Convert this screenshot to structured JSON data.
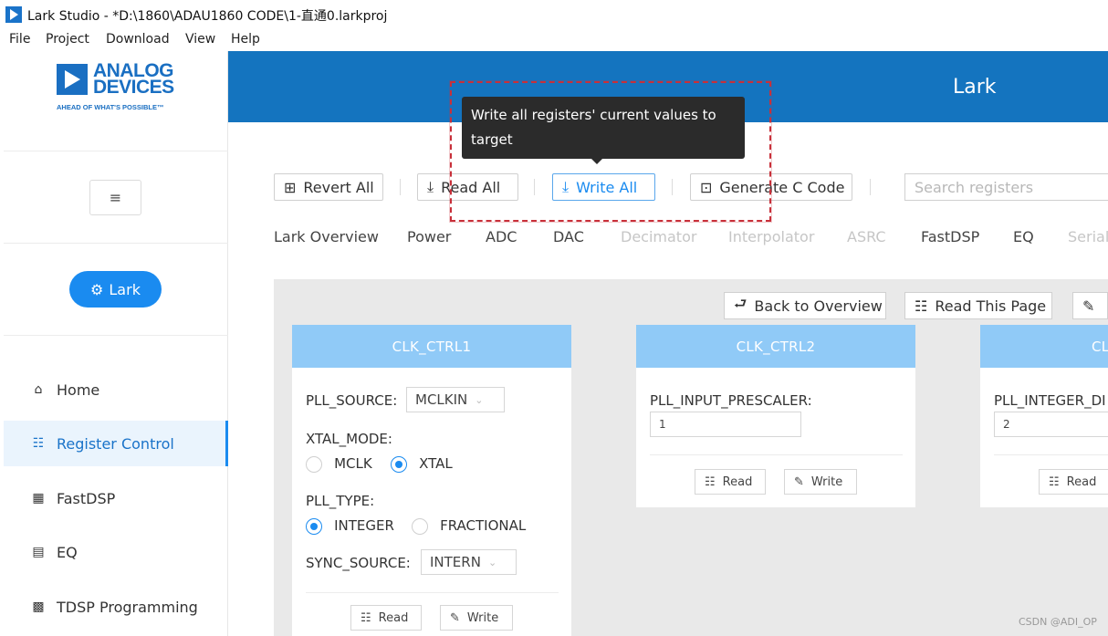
{
  "window": {
    "title": "Lark Studio - *D:\\1860\\ADAU1860 CODE\\1-直通0.larkproj"
  },
  "menu": [
    "File",
    "Project",
    "Download",
    "View",
    "Help"
  ],
  "brand": {
    "line1": "ANALOG",
    "line2": "DEVICES",
    "tagline": "AHEAD OF WHAT'S POSSIBLE™"
  },
  "sidebar": {
    "toggle_icon": "menu-fold-icon",
    "pill_label": "Lark",
    "items": [
      {
        "label": "Home",
        "icon": "home-icon"
      },
      {
        "label": "Register Control",
        "icon": "register-control-icon",
        "active": true
      },
      {
        "label": "FastDSP",
        "icon": "fastdsp-icon"
      },
      {
        "label": "EQ",
        "icon": "eq-icon"
      },
      {
        "label": "TDSP Programming",
        "icon": "tdsp-icon"
      }
    ]
  },
  "header": {
    "title": "Lark"
  },
  "toolbar": {
    "revert_all": "Revert All",
    "read_all": "Read All",
    "write_all": "Write All",
    "generate_c": "Generate C Code",
    "search_placeholder": "Search registers"
  },
  "tooltip": {
    "text": "Write all registers' current values to target"
  },
  "tabs": [
    {
      "label": "Lark Overview",
      "enabled": true
    },
    {
      "label": "Power",
      "enabled": true
    },
    {
      "label": "ADC",
      "enabled": true
    },
    {
      "label": "DAC",
      "enabled": true
    },
    {
      "label": "Decimator",
      "enabled": false
    },
    {
      "label": "Interpolator",
      "enabled": false
    },
    {
      "label": "ASRC",
      "enabled": false
    },
    {
      "label": "FastDSP",
      "enabled": true
    },
    {
      "label": "EQ",
      "enabled": true
    },
    {
      "label": "Serial",
      "enabled": false
    }
  ],
  "page_actions": {
    "back": "Back to Overview",
    "read_page": "Read This Page"
  },
  "cards": {
    "clk_ctrl1": {
      "title": "CLK_CTRL1",
      "pll_source_label": "PLL_SOURCE:",
      "pll_source_value": "MCLKIN",
      "xtal_mode_label": "XTAL_MODE:",
      "xtal_mode_options": [
        "MCLK",
        "XTAL"
      ],
      "xtal_mode_selected": "XTAL",
      "pll_type_label": "PLL_TYPE:",
      "pll_type_options": [
        "INTEGER",
        "FRACTIONAL"
      ],
      "pll_type_selected": "INTEGER",
      "sync_source_label": "SYNC_SOURCE:",
      "sync_source_value": "INTERN",
      "read": "Read",
      "write": "Write"
    },
    "clk_ctrl2": {
      "title": "CLK_CTRL2",
      "field_label": "PLL_INPUT_PRESCALER:",
      "field_value": "1",
      "read": "Read",
      "write": "Write"
    },
    "clk_ctrl3": {
      "title": "CLK",
      "field_label": "PLL_INTEGER_DI",
      "field_value": "2",
      "read": "Read"
    }
  },
  "watermark": "CSDN @ADI_OP",
  "colors": {
    "header_blue": "#1474bf",
    "accent": "#1a8bf0",
    "card_header": "#90caf7",
    "highlight_box": "#c8303a"
  }
}
